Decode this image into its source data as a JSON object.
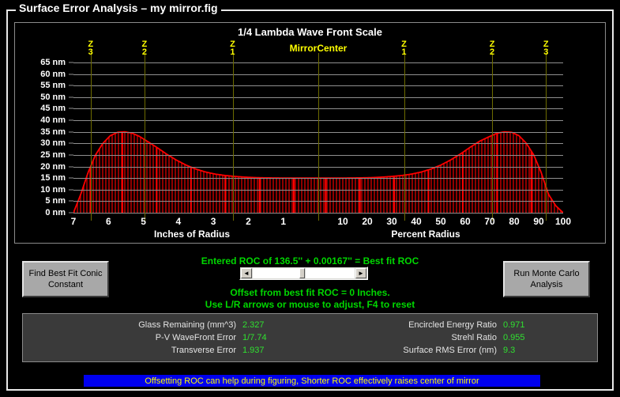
{
  "window": {
    "title": "Surface Error Analysis – my mirror.fig"
  },
  "chart_panel": {
    "title": "1/4 Lambda Wave Front Scale",
    "center_label_line1": "Mirror",
    "center_label_line2": "Center",
    "left_axis_title": "Inches of Radius",
    "right_axis_title": "Percent Radius",
    "zone_letter": "Z",
    "zones_left": [
      "3",
      "2",
      "1"
    ],
    "zones_right": [
      "1",
      "2",
      "3"
    ]
  },
  "chart_data": {
    "type": "area",
    "title": "1/4 Lambda Wave Front Scale",
    "xlabel": "Inches of Radius / Percent Radius",
    "ylabel": "nm",
    "ylim": [
      0,
      65
    ],
    "grid": true,
    "legend_position": "none",
    "series_color": "#ff0000",
    "y_ticks": [
      0,
      5,
      10,
      15,
      20,
      25,
      30,
      35,
      40,
      45,
      50,
      55,
      60,
      65
    ],
    "y_tick_labels": [
      "0 nm",
      "5 nm",
      "10 nm",
      "15 nm",
      "20 nm",
      "25 nm",
      "30 nm",
      "35 nm",
      "40 nm",
      "45 nm",
      "50 nm",
      "55 nm",
      "60 nm",
      "65 nm"
    ],
    "x_left_ticks": [
      7,
      6,
      5,
      4,
      3,
      2,
      1
    ],
    "x_left_tick_labels": [
      "7",
      "6",
      "5",
      "4",
      "3",
      "2",
      "1"
    ],
    "x_right_ticks": [
      10,
      20,
      30,
      40,
      50,
      60,
      70,
      80,
      90,
      100
    ],
    "x_right_tick_labels": [
      "10",
      "20",
      "30",
      "40",
      "50",
      "60",
      "70",
      "80",
      "90",
      "100"
    ],
    "zone_marker_percent": [
      -93,
      -71,
      -35,
      0,
      35,
      71,
      93
    ],
    "zone_marker_labels": [
      "Z3",
      "Z2",
      "Z1",
      "Mirror Center",
      "Z1",
      "Z2",
      "Z3"
    ],
    "x_percent": [
      -100,
      -97,
      -94,
      -91,
      -88,
      -85,
      -82,
      -79,
      -76,
      -73,
      -70,
      -66,
      -62,
      -58,
      -54,
      -50,
      -46,
      -42,
      -38,
      -34,
      -30,
      -26,
      -22,
      -18,
      -14,
      -10,
      -6,
      -2,
      0,
      2,
      6,
      10,
      14,
      18,
      22,
      26,
      30,
      34,
      38,
      42,
      46,
      50,
      54,
      58,
      62,
      66,
      70,
      73,
      76,
      79,
      82,
      85,
      88,
      91,
      94,
      97,
      100
    ],
    "y_nm": [
      0,
      8,
      17.5,
      25,
      30,
      33.3,
      34.8,
      35,
      34.4,
      33,
      31,
      28.3,
      25.4,
      22.8,
      20.6,
      18.9,
      17.6,
      16.7,
      16.1,
      15.7,
      15.4,
      15.2,
      15.1,
      15.05,
      15,
      15,
      15,
      15,
      15,
      15,
      15,
      15,
      15.05,
      15.1,
      15.2,
      15.4,
      15.7,
      16.1,
      16.7,
      17.6,
      18.9,
      20.6,
      22.8,
      25.4,
      28.3,
      31,
      33,
      34.4,
      35,
      34.8,
      33.3,
      30,
      25,
      17.5,
      8,
      3,
      0
    ]
  },
  "buttons": {
    "find_best_fit": "Find Best Fit Conic\nConstant",
    "find_best_fit_line1": "Find Best Fit Conic",
    "find_best_fit_line2": "Constant",
    "monte_carlo_line1": "Run Monte Carlo",
    "monte_carlo_line2": "Analysis"
  },
  "roc": {
    "entered_line": "Entered ROC of 136.5'' + 0.00167'' = Best fit ROC",
    "offset_line": "Offset from best fit ROC = 0 Inches.",
    "hint_line": "Use L/R arrows or mouse to adjust, F4 to reset",
    "scrollbar_left_arrow": "◄",
    "scrollbar_right_arrow": "►"
  },
  "results": {
    "left": [
      {
        "label": "Glass Remaining (mm^3)",
        "value": "2.327"
      },
      {
        "label": "P-V WaveFront Error",
        "value": "1/7.74"
      },
      {
        "label": "Transverse Error",
        "value": "1.937"
      }
    ],
    "right": [
      {
        "label": "Encircled Energy Ratio",
        "value": "0.971"
      },
      {
        "label": "Strehl Ratio",
        "value": "0.955"
      },
      {
        "label": "Surface RMS Error (nm)",
        "value": "9.3"
      }
    ]
  },
  "status_bar": {
    "message": "Offsetting ROC can help during figuring, Shorter ROC effectively raises center of mirror"
  }
}
